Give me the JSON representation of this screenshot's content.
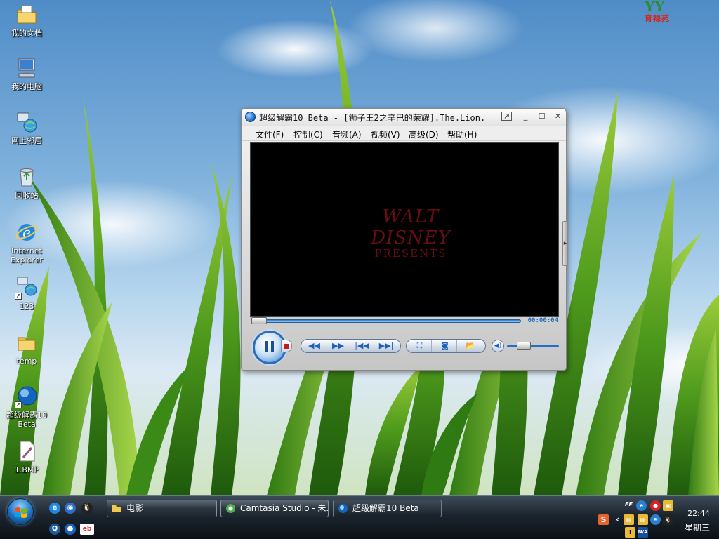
{
  "desktop": {
    "logo_text": "育禄苑",
    "logo_mark": "YY",
    "icons": [
      {
        "label": "我的文档"
      },
      {
        "label": "我的电脑"
      },
      {
        "label": "网上邻居"
      },
      {
        "label": "回收站"
      },
      {
        "label": "Internet Explorer"
      },
      {
        "label": "123"
      },
      {
        "label": "temp"
      },
      {
        "label": "超级解霸10 Beta"
      },
      {
        "label": "1.BMP"
      }
    ]
  },
  "player": {
    "title": "超级解霸10 Beta - [狮子王2之辛巴的荣耀].The.Lion.",
    "menu": [
      {
        "label": "文件(F)"
      },
      {
        "label": "控制(C)"
      },
      {
        "label": "音频(A)"
      },
      {
        "label": "视频(V)"
      },
      {
        "label": "高级(D)"
      },
      {
        "label": "帮助(H)"
      }
    ],
    "video_text_line1": "WALT DISNEY",
    "video_text_line2": "PRESENTS",
    "time": "00:00:04",
    "seek_progress": 0.0,
    "volume_level": 0.25
  },
  "taskbar": {
    "tasks": [
      {
        "label": "电影"
      },
      {
        "label": "Camtasia Studio - 未..."
      },
      {
        "label": "超级解霸10 Beta"
      }
    ],
    "clock_time": "22:44",
    "clock_day": "星期三",
    "tray_labels": {
      "ff": "FF",
      "na": "N/A"
    }
  },
  "colors": {
    "accent": "#1f6fc6",
    "disney_red": "#6a0d12",
    "taskbar": "#1b252e"
  }
}
